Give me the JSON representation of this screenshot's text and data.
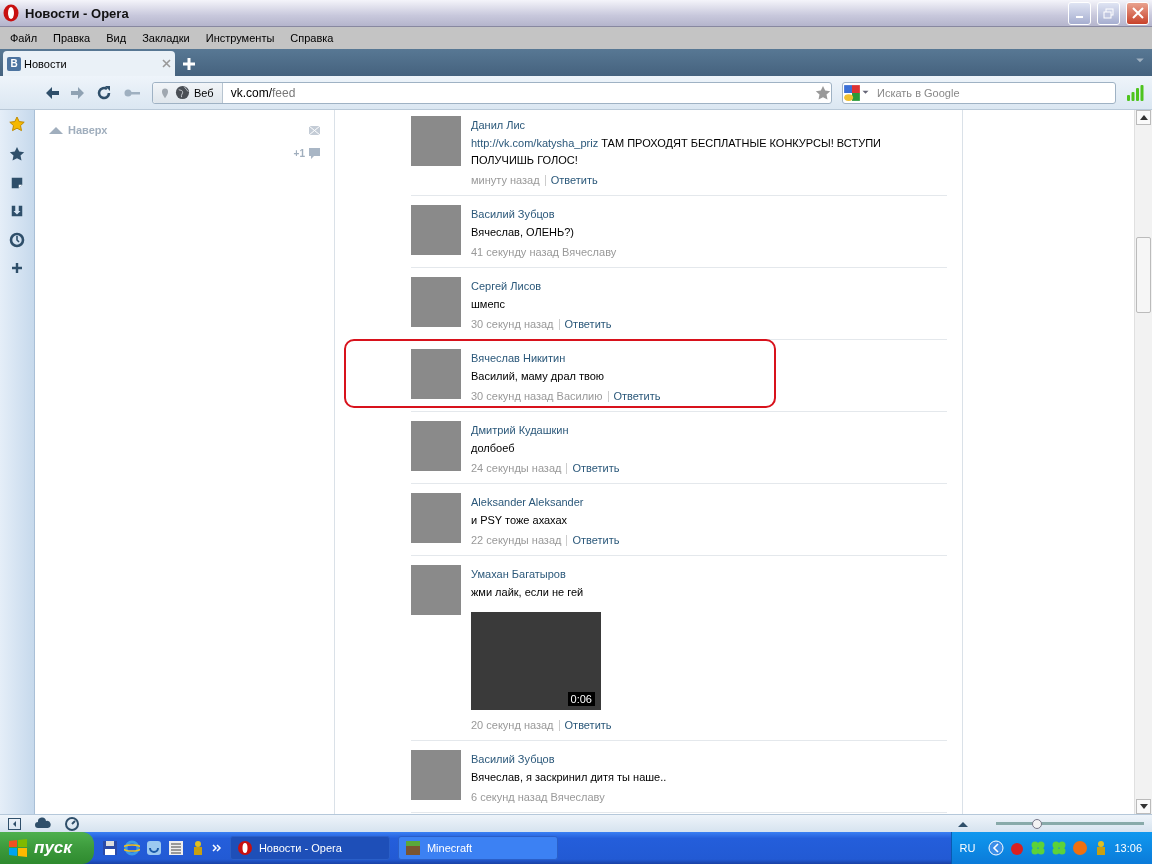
{
  "window": {
    "title": "Новости - Opera"
  },
  "menu": [
    "Файл",
    "Правка",
    "Вид",
    "Закладки",
    "Инструменты",
    "Справка"
  ],
  "tabs": [
    {
      "label": "Новости",
      "favicon": "В",
      "selected": true
    }
  ],
  "address_bar": {
    "scheme": "Веб",
    "host": "vk.com/",
    "path": "feed"
  },
  "search": {
    "placeholder": "Искать в Google"
  },
  "left_column": {
    "up_link": "Наверх",
    "counter": "+1"
  },
  "feed": [
    {
      "author": "Данил Лис",
      "link": "http://vk.com/katysha_priz",
      "text": "ТАМ ПРОХОДЯТ БЕСПЛАТНЫЕ КОНКУРСЫ! ВСТУПИ ПОЛУЧИШЬ ГОЛОС!",
      "time": "минуту назад",
      "reply": "Ответить",
      "highlighted": false
    },
    {
      "author": "Василий Зубцов",
      "text": "Вячеслав, ОЛЕНЬ?)",
      "time": "41 секунду назад Вячеславу",
      "highlighted": false
    },
    {
      "author": "Сергей Лисов",
      "text": "шмепс",
      "time": "30 секунд назад",
      "reply": "Ответить",
      "highlighted": false
    },
    {
      "author": "Вячеслав Никитин",
      "text": "Василий, маму драл твою",
      "time": "30 секунд назад Василию",
      "reply": "Ответить",
      "highlighted": true
    },
    {
      "author": "Дмитрий Кудашкин",
      "text": "долбоеб",
      "time": "24 секунды назад",
      "reply": "Ответить",
      "highlighted": false
    },
    {
      "author": "Aleksander Aleksander",
      "text": "и PSY тоже ахахах",
      "time": "22 секунды назад",
      "reply": "Ответить",
      "highlighted": false
    },
    {
      "author": "Умахан Багатыров",
      "text": "жми лайк, если не гей",
      "video": {
        "duration": "0:06"
      },
      "time": "20 секунд назад",
      "reply": "Ответить",
      "highlighted": false
    },
    {
      "author": "Василий Зубцов",
      "text": "Вячеслав, я заскринил дитя ты наше..",
      "time": "6 секунд назад Вячеславу",
      "highlighted": false
    }
  ],
  "status_bar": {
    "zoom": {
      "level": 0.28
    }
  },
  "taskbar": {
    "start": "пуск",
    "tasks": [
      {
        "label": "Новости - Opera",
        "selected": true
      },
      {
        "label": "Minecraft",
        "selected": false
      }
    ],
    "language": "RU",
    "clock": "13:06"
  }
}
